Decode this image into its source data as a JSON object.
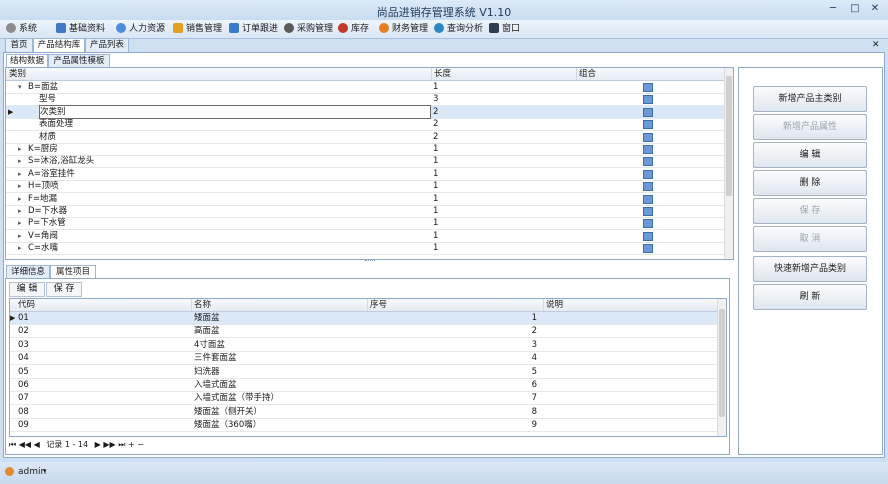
{
  "window": {
    "title": "尚品进销存管理系统 V1.10"
  },
  "menu": [
    {
      "label": "系统",
      "color": "#8c8c8c"
    },
    {
      "label": "基础资料",
      "color": "#3f78c4"
    },
    {
      "label": "人力资源",
      "color": "#4d8ed9"
    },
    {
      "label": "销售管理",
      "color": "#e0a020"
    },
    {
      "label": "订单跟进",
      "color": "#3a7cc9"
    },
    {
      "label": "采购管理",
      "color": "#5a5a5a"
    },
    {
      "label": "库存",
      "color": "#c0392b"
    },
    {
      "label": "财务管理",
      "color": "#e67e22"
    },
    {
      "label": "查询分析",
      "color": "#2e86c1"
    },
    {
      "label": "窗口",
      "color": "#2c3e50"
    }
  ],
  "main_tabs": [
    "首页",
    "产品结构库",
    "产品列表"
  ],
  "sub_tabs": [
    "结构数据",
    "产品属性模板"
  ],
  "tree": {
    "columns": [
      "类别",
      "长度",
      "组合"
    ],
    "rows": [
      {
        "name": "B=面盆",
        "len": "1",
        "level": 0,
        "expand": "▾"
      },
      {
        "name": "型号",
        "len": "3",
        "level": 1,
        "expand": ""
      },
      {
        "name": "次类别",
        "len": "2",
        "level": 1,
        "expand": ""
      },
      {
        "name": "表面处理",
        "len": "2",
        "level": 1,
        "expand": ""
      },
      {
        "name": "材质",
        "len": "2",
        "level": 1,
        "expand": ""
      },
      {
        "name": "K=厨房",
        "len": "1",
        "level": 0,
        "expand": "▸"
      },
      {
        "name": "S=沐浴,浴缸龙头",
        "len": "1",
        "level": 0,
        "expand": "▸"
      },
      {
        "name": "A=浴室挂件",
        "len": "1",
        "level": 0,
        "expand": "▸"
      },
      {
        "name": "H=顶喷",
        "len": "1",
        "level": 0,
        "expand": "▸"
      },
      {
        "name": "F=地漏",
        "len": "1",
        "level": 0,
        "expand": "▸"
      },
      {
        "name": "D=下水器",
        "len": "1",
        "level": 0,
        "expand": "▸"
      },
      {
        "name": "P=下水管",
        "len": "1",
        "level": 0,
        "expand": "▸"
      },
      {
        "name": "V=角阀",
        "len": "1",
        "level": 0,
        "expand": "▸"
      },
      {
        "name": "C=水嘴",
        "len": "1",
        "level": 0,
        "expand": "▸"
      }
    ]
  },
  "detail_tabs": [
    "详细信息",
    "属性项目"
  ],
  "detail_toolbar": {
    "edit": "编 辑",
    "save": "保 存"
  },
  "attr_grid": {
    "columns": [
      "代码",
      "名称",
      "序号",
      "说明"
    ],
    "rows": [
      {
        "code": "01",
        "name": "矮面盆",
        "seq": "1",
        "note": ""
      },
      {
        "code": "02",
        "name": "高面盆",
        "seq": "2",
        "note": ""
      },
      {
        "code": "03",
        "name": "4寸面盆",
        "seq": "3",
        "note": ""
      },
      {
        "code": "04",
        "name": "三件套面盆",
        "seq": "4",
        "note": ""
      },
      {
        "code": "05",
        "name": "妇洗器",
        "seq": "5",
        "note": ""
      },
      {
        "code": "06",
        "name": "入墙式面盆",
        "seq": "6",
        "note": ""
      },
      {
        "code": "07",
        "name": "入墙式面盆（带手持）",
        "seq": "7",
        "note": ""
      },
      {
        "code": "08",
        "name": "矮面盆（侧开关）",
        "seq": "8",
        "note": ""
      },
      {
        "code": "09",
        "name": "矮面盆（360嘴）",
        "seq": "9",
        "note": ""
      }
    ]
  },
  "navigator": {
    "record_text": "记录 1 - 14"
  },
  "buttons": [
    {
      "label": "新增产品主类别",
      "enabled": true
    },
    {
      "label": "新增产品属性",
      "enabled": false
    },
    {
      "label": "编 辑",
      "enabled": true
    },
    {
      "label": "删 除",
      "enabled": true
    },
    {
      "label": "保 存",
      "enabled": false
    },
    {
      "label": "取 消",
      "enabled": false
    },
    {
      "label": "快速新增产品类别",
      "enabled": true
    },
    {
      "label": "刷 新",
      "enabled": true
    }
  ],
  "status": {
    "user": "admin"
  }
}
